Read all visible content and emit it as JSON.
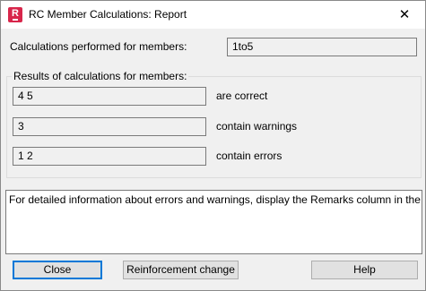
{
  "window": {
    "title": "RC Member Calculations: Report",
    "close_glyph": "✕",
    "app_icon_letter": "R"
  },
  "performed": {
    "label": "Calculations performed for members:",
    "value": "1to5"
  },
  "results": {
    "group_title": "Results of calculations for members:",
    "correct": {
      "value": "4 5",
      "label": "are correct"
    },
    "warnings": {
      "value": "3",
      "label": "contain warnings"
    },
    "errors": {
      "value": "1 2",
      "label": "contain errors"
    }
  },
  "remarks_text": "For detailed information about errors and warnings, display the Remarks column in the bar reinforcement table.",
  "buttons": {
    "close": "Close",
    "reinforcement_change": "Reinforcement change",
    "help": "Help"
  }
}
